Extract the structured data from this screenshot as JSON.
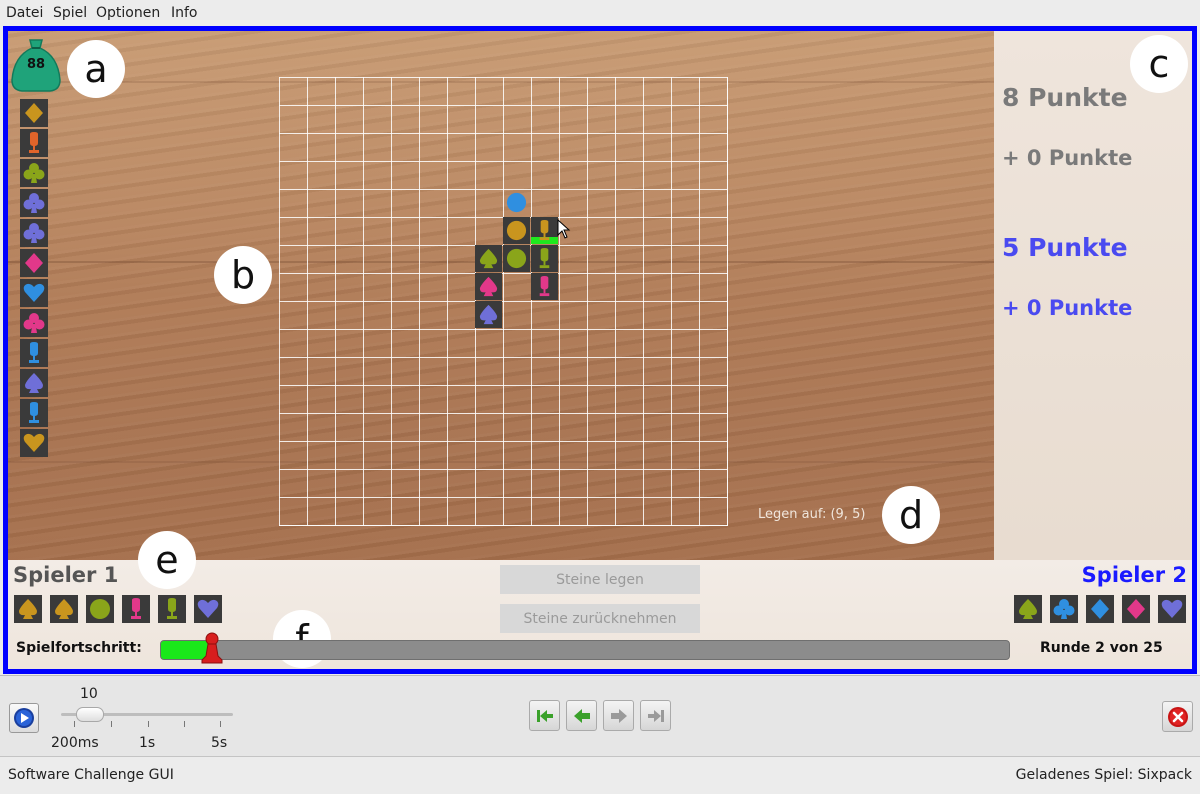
{
  "menu": [
    "Datei",
    "Spiel",
    "Optionen",
    "Info"
  ],
  "bag": {
    "count": "88"
  },
  "labels": {
    "a": "a",
    "b": "b",
    "c": "c",
    "d": "d",
    "e": "e",
    "f": "f"
  },
  "scores": {
    "p1_total": "8 Punkte",
    "p1_turn": "+ 0 Punkte",
    "p2_total": "5 Punkte",
    "p2_turn": "+ 0 Punkte"
  },
  "legen_auf": "Legen auf: (9, 5)",
  "player1": {
    "name": "Spieler 1",
    "color": "#555555"
  },
  "player2": {
    "name": "Spieler 2",
    "color": "#1a1aff"
  },
  "buttons": {
    "place": "Steine legen",
    "undo": "Steine zurücknehmen"
  },
  "progress": {
    "label": "Spielfortschritt:",
    "round_text": "Runde 2 von 25",
    "fraction": 0.06
  },
  "speed": {
    "value": "10",
    "ticks": [
      "200ms",
      "1s",
      "5s"
    ]
  },
  "status": {
    "left": "Software Challenge GUI",
    "right": "Geladenes Spiel: Sixpack"
  },
  "colors": {
    "yellow": "#c9951e",
    "orange": "#e0642a",
    "olive": "#8aa51a",
    "violet": "#6f6fd8",
    "pink": "#e2388a",
    "blue": "#2f8fe0",
    "frame": "#0000ff"
  },
  "stack_tiles": [
    {
      "icon": "diamond-icon",
      "color": "#c9951e"
    },
    {
      "icon": "acorn-icon",
      "color": "#e0642a"
    },
    {
      "icon": "club-icon",
      "color": "#8aa51a"
    },
    {
      "icon": "club-icon",
      "color": "#6f6fd8"
    },
    {
      "icon": "club-icon",
      "color": "#6f6fd8"
    },
    {
      "icon": "diamond-icon",
      "color": "#e2388a"
    },
    {
      "icon": "heart-icon",
      "color": "#2f8fe0"
    },
    {
      "icon": "club-icon",
      "color": "#e2388a"
    },
    {
      "icon": "acorn-icon",
      "color": "#2f8fe0"
    },
    {
      "icon": "spade-icon",
      "color": "#6f6fd8"
    },
    {
      "icon": "acorn-icon",
      "color": "#2f8fe0"
    },
    {
      "icon": "heart-icon",
      "color": "#c9951e"
    }
  ],
  "p1_rack": [
    {
      "icon": "spade-icon",
      "color": "#c9951e"
    },
    {
      "icon": "spade-icon",
      "color": "#c9951e"
    },
    {
      "icon": "circle-icon",
      "color": "#8aa51a"
    },
    {
      "icon": "acorn-icon",
      "color": "#e2388a"
    },
    {
      "icon": "acorn-icon",
      "color": "#8aa51a"
    },
    {
      "icon": "heart-icon",
      "color": "#6f6fd8"
    }
  ],
  "p2_rack": [
    {
      "icon": "spade-icon",
      "color": "#8aa51a"
    },
    {
      "icon": "club-icon",
      "color": "#2f8fe0"
    },
    {
      "icon": "diamond-icon",
      "color": "#2f8fe0"
    },
    {
      "icon": "diamond-icon",
      "color": "#e2388a"
    },
    {
      "icon": "heart-icon",
      "color": "#6f6fd8"
    }
  ],
  "board_tiles": [
    {
      "col": 8,
      "row": 4,
      "icon": "circle-icon",
      "color": "#2f8fe0",
      "dark": false
    },
    {
      "col": 8,
      "row": 5,
      "icon": "circle-icon",
      "color": "#c9951e",
      "dark": true
    },
    {
      "col": 9,
      "row": 5,
      "icon": "acorn-icon",
      "color": "#c9951e",
      "dark": true,
      "highlight": true
    },
    {
      "col": 7,
      "row": 6,
      "icon": "spade-icon",
      "color": "#8aa51a",
      "dark": true
    },
    {
      "col": 8,
      "row": 6,
      "icon": "circle-icon",
      "color": "#8aa51a",
      "dark": true
    },
    {
      "col": 9,
      "row": 6,
      "icon": "acorn-icon",
      "color": "#8aa51a",
      "dark": true
    },
    {
      "col": 7,
      "row": 7,
      "icon": "spade-icon",
      "color": "#e2388a",
      "dark": true
    },
    {
      "col": 9,
      "row": 7,
      "icon": "acorn-icon",
      "color": "#e2388a",
      "dark": true
    },
    {
      "col": 7,
      "row": 8,
      "icon": "spade-icon",
      "color": "#6f6fd8",
      "dark": true
    }
  ]
}
